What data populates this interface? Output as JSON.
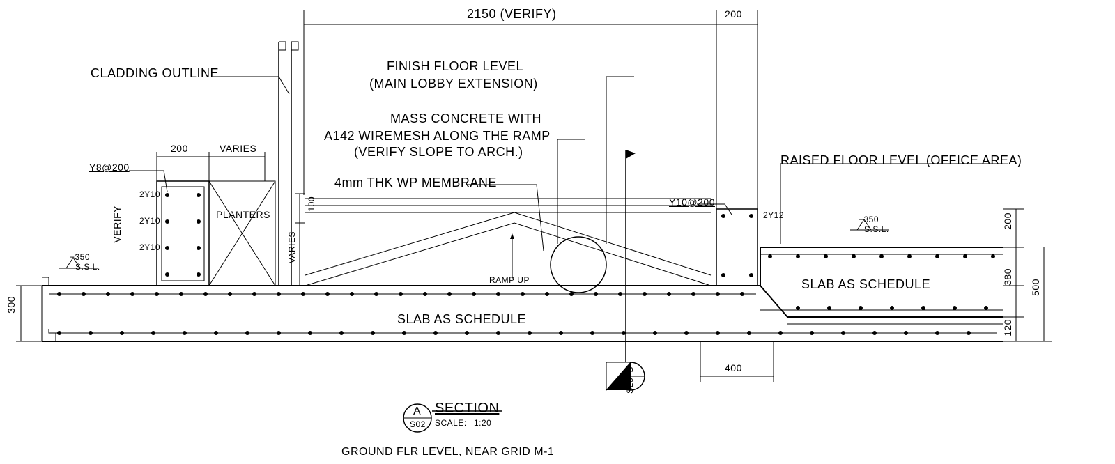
{
  "dims": {
    "top_main": "2150 (VERIFY)",
    "top_right_200": "200",
    "left_200": "200",
    "left_varies": "VARIES",
    "left_300": "300",
    "right_200": "200",
    "right_380": "380",
    "right_120": "120",
    "right_500": "500",
    "bottom_400": "400",
    "mid_100": "100",
    "mid_varies": "VARIES"
  },
  "notes": {
    "cladding": "CLADDING OUTLINE",
    "finish1": "FINISH FLOOR LEVEL",
    "finish2": "(MAIN LOBBY EXTENSION)",
    "mass1": "MASS CONCRETE WITH",
    "mass2": "A142 WIREMESH ALONG THE RAMP",
    "mass3": "(VERIFY SLOPE TO ARCH.)",
    "wp": "4mm THK WP MEMBRANE",
    "raised": "RAISED FLOOR LEVEL (OFFICE AREA)",
    "planters": "PLANTERS",
    "verify_v": "VERIFY",
    "slab1": "SLAB AS SCHEDULE",
    "slab2": "SLAB AS SCHEDULE",
    "ramp_up": "RAMP UP",
    "ssl": "S.S.L.",
    "plus350_1": "+350",
    "plus350_2": "+350"
  },
  "rebar": {
    "y8": "Y8@200",
    "y10": "Y10@200",
    "r1": "2Y10",
    "r2": "2Y10",
    "r3": "2Y10",
    "r4": "2Y12"
  },
  "title": {
    "letter": "A",
    "sheet": "S02",
    "name": "SECTION",
    "scale_lbl": "SCALE:",
    "scale_val": "1:20",
    "subtitle": "GROUND FLR LEVEL, NEAR GRID M-1"
  },
  "marker": {
    "b": "B",
    "s28": "S28"
  }
}
